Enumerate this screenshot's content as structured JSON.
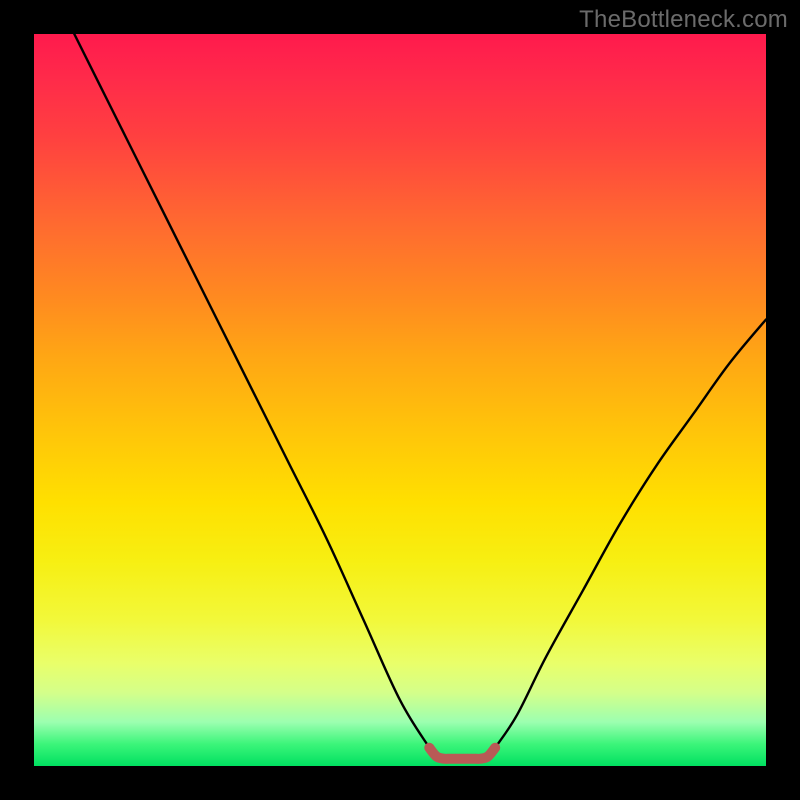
{
  "watermark": {
    "text": "TheBottleneck.com"
  },
  "colors": {
    "frame": "#000000",
    "watermark": "#6b6b6b",
    "curve": "#000000",
    "marker": "#b85a56",
    "gradient_stops": [
      "#ff1a4d",
      "#ff2a4a",
      "#ff4040",
      "#ff6a30",
      "#ff8a20",
      "#ffa614",
      "#ffc40a",
      "#ffe000",
      "#f7ef12",
      "#f2f83a",
      "#e9ff6a",
      "#d4ff8a",
      "#9cffb0",
      "#3cf57a",
      "#00e060"
    ]
  },
  "chart_data": {
    "type": "line",
    "title": "",
    "xlabel": "",
    "ylabel": "",
    "xlim": [
      0,
      100
    ],
    "ylim": [
      0,
      100
    ],
    "grid": false,
    "legend": false,
    "note": "Axes are unlabeled in the image; 0–100 normalized from plot-area pixels.",
    "series": [
      {
        "name": "left-branch",
        "x": [
          5.5,
          10,
          15,
          20,
          25,
          30,
          35,
          40,
          45,
          50,
          54
        ],
        "y": [
          100,
          91,
          81,
          71,
          61,
          51,
          41,
          31,
          20,
          9,
          2.5
        ]
      },
      {
        "name": "right-branch",
        "x": [
          63,
          66,
          70,
          75,
          80,
          85,
          90,
          95,
          100
        ],
        "y": [
          2.5,
          7,
          15,
          24,
          33,
          41,
          48,
          55,
          61
        ]
      },
      {
        "name": "bottom-marker",
        "x": [
          54,
          55,
          56,
          57,
          58.5,
          60,
          61,
          62,
          63
        ],
        "y": [
          2.5,
          1.3,
          1.0,
          1.0,
          1.0,
          1.0,
          1.0,
          1.3,
          2.5
        ]
      }
    ]
  }
}
